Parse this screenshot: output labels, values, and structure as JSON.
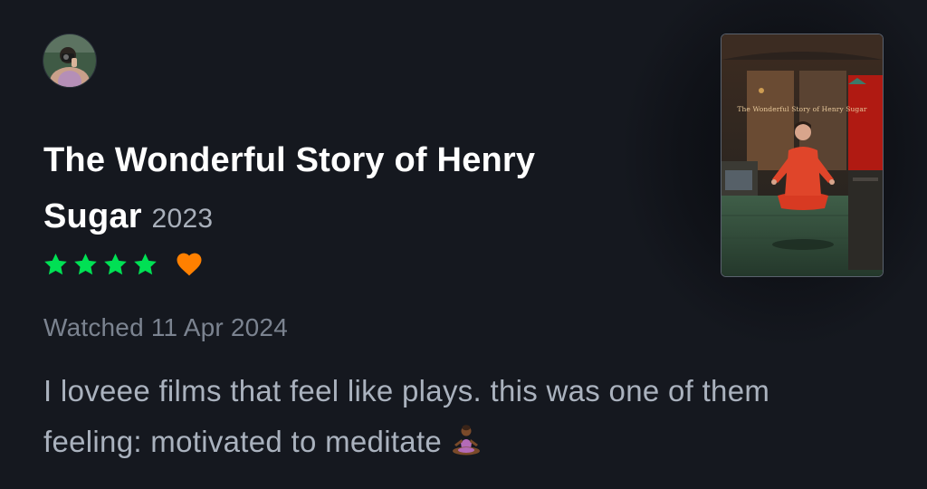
{
  "film": {
    "title": "The Wonderful Story of Henry Sugar",
    "year": "2023"
  },
  "rating": {
    "stars": 4,
    "liked": true,
    "colors": {
      "star": "#00e054",
      "heart": "#ff8000"
    }
  },
  "watched_label": "Watched 11 Apr 2024",
  "review": {
    "line1": "I loveee films that feel like plays. this was one of them",
    "line2": "feeling: motivated to meditate",
    "emoji": "woman-in-lotus-position-icon"
  },
  "poster": {
    "title": "The Wonderful Story of Henry Sugar"
  },
  "avatar": {
    "icon": "user-avatar-icon"
  }
}
